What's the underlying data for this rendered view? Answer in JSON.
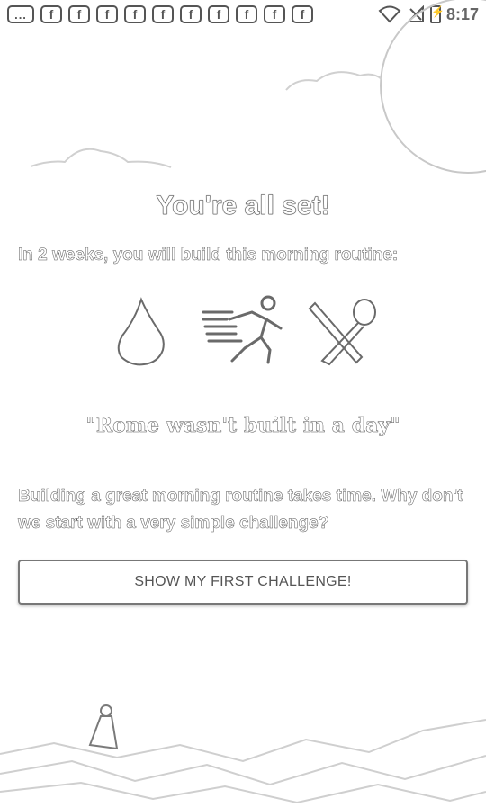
{
  "status_bar": {
    "notification_icons": [
      "...",
      "f",
      "f",
      "f",
      "f",
      "f",
      "f",
      "f",
      "f",
      "f",
      "f"
    ],
    "time": "8:17",
    "icons": [
      "wifi-icon",
      "no-signal-icon",
      "battery-charging-icon"
    ]
  },
  "onboarding": {
    "title": "You're all set!",
    "subtitle": "In 2 weeks, you will build this morning routine:",
    "routine_icons": [
      "water-drop-icon",
      "running-person-icon",
      "no-eating-icon"
    ],
    "quote": "\"Rome wasn't built in a day\"",
    "paragraph": "Building a great morning routine takes time. Why don't we start with a very simple challenge?",
    "cta_label": "SHOW MY FIRST CHALLENGE!"
  }
}
